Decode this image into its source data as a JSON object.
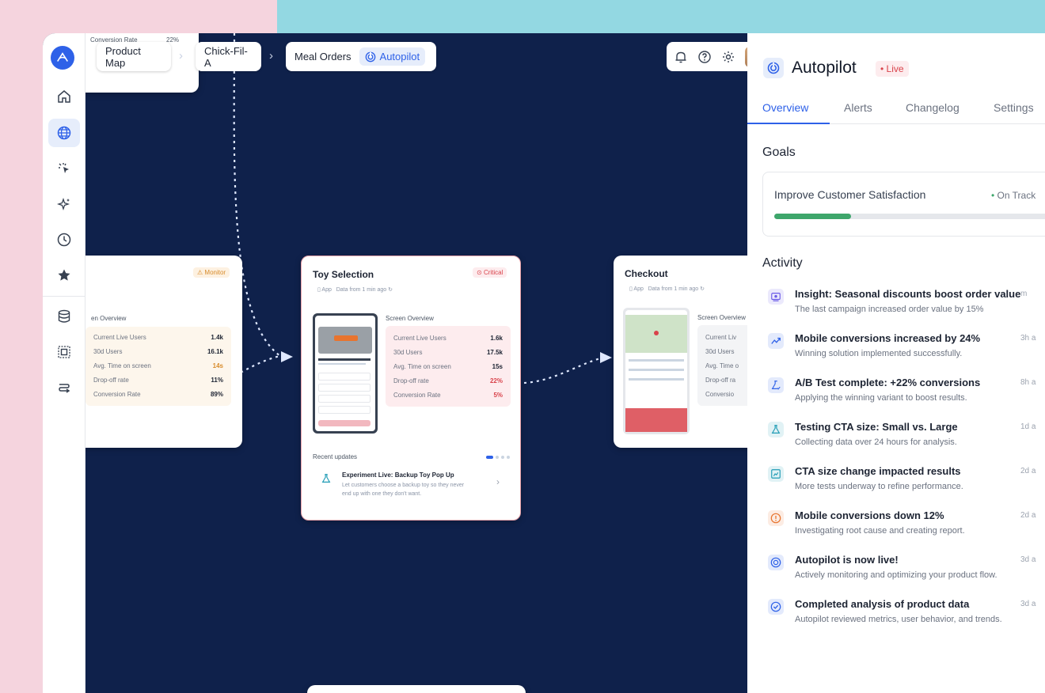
{
  "breadcrumb": {
    "items": [
      "Product Map",
      "Chick-Fil-A",
      "Meal Orders"
    ],
    "active_pill": "Autopilot"
  },
  "top_left_card": {
    "label": "Conversion Rate",
    "value": "22%"
  },
  "left_node": {
    "badge": "Monitor",
    "overview_label": "en Overview",
    "metrics": [
      {
        "label": "Current Live Users",
        "value": "1.4k"
      },
      {
        "label": "30d Users",
        "value": "16.1k"
      },
      {
        "label": "Avg. Time on screen",
        "value": "14s"
      },
      {
        "label": "Drop-off rate",
        "value": "11%"
      },
      {
        "label": "Conversion Rate",
        "value": "89%"
      }
    ]
  },
  "center_node": {
    "title": "Toy Selection",
    "badge": "Critical",
    "meta_app": "App",
    "meta_data": "Data from 1 min ago",
    "overview_label": "Screen Overview",
    "metrics": [
      {
        "label": "Current Live Users",
        "value": "1.6k"
      },
      {
        "label": "30d Users",
        "value": "17.5k"
      },
      {
        "label": "Avg. Time on screen",
        "value": "15s"
      },
      {
        "label": "Drop-off rate",
        "value": "22%"
      },
      {
        "label": "Conversion Rate",
        "value": "5%"
      }
    ],
    "recent_label": "Recent updates",
    "update_title": "Experiment Live: Backup Toy Pop Up",
    "update_desc_1": "Let customers choose a backup toy so they never",
    "update_desc_2": "end up with one they don't want."
  },
  "right_node": {
    "title": "Checkout",
    "meta_app": "App",
    "meta_data": "Data from 1 min ago",
    "overview_label": "Screen Overview",
    "metrics": [
      {
        "label": "Current Liv"
      },
      {
        "label": "30d Users"
      },
      {
        "label": "Avg. Time o"
      },
      {
        "label": "Drop-off ra"
      },
      {
        "label": "Conversio"
      }
    ]
  },
  "panel": {
    "title": "Autopilot",
    "live_badge": "Live",
    "tabs": [
      "Overview",
      "Alerts",
      "Changelog",
      "Settings"
    ],
    "goals_heading": "Goals",
    "goal": {
      "name": "Improve Customer Satisfaction",
      "status": "On Track",
      "progress": 0.27
    },
    "activity_heading": "Activity",
    "activity": [
      {
        "title": "Insight: Seasonal discounts boost order value",
        "desc": "The last campaign increased order value by 15%",
        "time": "m",
        "icon": "insight-icon",
        "color": "#6c5ce7"
      },
      {
        "title": "Mobile conversions increased by 24%",
        "desc": "Winning solution implemented successfully.",
        "time": "3h a",
        "icon": "trend-up-icon",
        "color": "#2e61e8"
      },
      {
        "title": "A/B Test complete: +22% conversions",
        "desc": "Applying the winning variant to boost results.",
        "time": "8h a",
        "icon": "flask-check-icon",
        "color": "#2e61e8"
      },
      {
        "title": "Testing CTA size: Small vs. Large",
        "desc": "Collecting data over 24 hours for analysis.",
        "time": "1d a",
        "icon": "flask-icon",
        "color": "#1f9bb5"
      },
      {
        "title": "CTA size change impacted results",
        "desc": "More tests underway to refine performance.",
        "time": "2d a",
        "icon": "chart-box-icon",
        "color": "#1f9bb5"
      },
      {
        "title": "Mobile conversions down 12%",
        "desc": "Investigating root cause and creating report.",
        "time": "2d a",
        "icon": "alert-icon",
        "color": "#e8742e"
      },
      {
        "title": "Autopilot is now live!",
        "desc": "Actively monitoring and optimizing your product flow.",
        "time": "3d a",
        "icon": "autopilot-icon",
        "color": "#2e61e8"
      },
      {
        "title": "Completed analysis of product data",
        "desc": "Autopilot reviewed metrics, user behavior, and trends.",
        "time": "3d a",
        "icon": "check-circle-icon",
        "color": "#2e61e8"
      }
    ]
  }
}
